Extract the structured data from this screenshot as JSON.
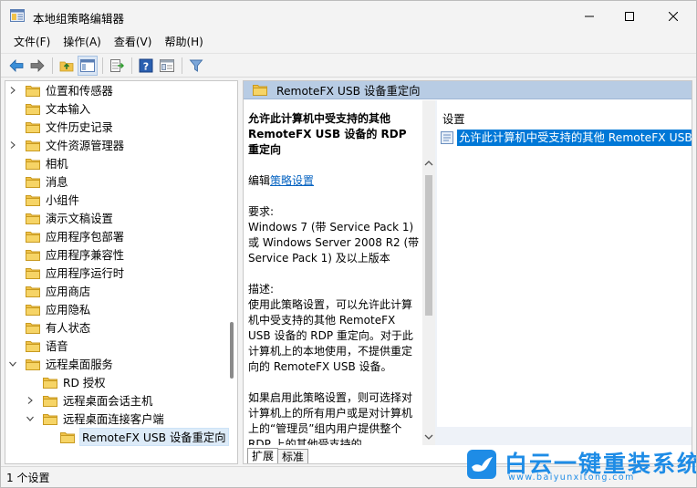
{
  "window": {
    "title": "本地组策略编辑器",
    "colors": {
      "accent": "#0078d7",
      "header": "#b8cce4",
      "folder": "#f0c24a"
    }
  },
  "menu": [
    "文件(F)",
    "操作(A)",
    "查看(V)",
    "帮助(H)"
  ],
  "toolbar_icons": [
    "back-arrow-icon",
    "forward-arrow-icon",
    "up-folder-icon",
    "show-hide-tree-icon",
    "export-list-icon",
    "help-icon",
    "properties-icon",
    "filter-icon"
  ],
  "tree": {
    "items": [
      {
        "label": "位置和传感器",
        "expander": "right"
      },
      {
        "label": "文本输入",
        "expander": "none"
      },
      {
        "label": "文件历史记录",
        "expander": "none"
      },
      {
        "label": "文件资源管理器",
        "expander": "right"
      },
      {
        "label": "相机",
        "expander": "none"
      },
      {
        "label": "消息",
        "expander": "none"
      },
      {
        "label": "小组件",
        "expander": "none"
      },
      {
        "label": "演示文稿设置",
        "expander": "none"
      },
      {
        "label": "应用程序包部署",
        "expander": "none"
      },
      {
        "label": "应用程序兼容性",
        "expander": "none"
      },
      {
        "label": "应用程序运行时",
        "expander": "none"
      },
      {
        "label": "应用商店",
        "expander": "none"
      },
      {
        "label": "应用隐私",
        "expander": "none"
      },
      {
        "label": "有人状态",
        "expander": "none"
      },
      {
        "label": "语音",
        "expander": "none"
      },
      {
        "label": "远程桌面服务",
        "expander": "down"
      },
      {
        "label": "RD 授权",
        "expander": "none"
      },
      {
        "label": "远程桌面会话主机",
        "expander": "right"
      },
      {
        "label": "远程桌面连接客户端",
        "expander": "down"
      },
      {
        "label": "RemoteFX USB 设备重定向",
        "expander": "none",
        "selected": true
      }
    ]
  },
  "right_panel": {
    "header": "RemoteFX USB 设备重定向",
    "description": {
      "title": "允许此计算机中受支持的其他 RemoteFX USB 设备的 RDP 重定向",
      "edit_prefix": "编辑",
      "edit_link": "策略设置",
      "requirements_label": "要求:",
      "requirements_text": "Windows 7 (带 Service Pack 1) 或 Windows Server 2008 R2 (带 Service Pack 1) 及以上版本",
      "desc_label": "描述:",
      "desc_text": "使用此策略设置，可以允许此计算机中受支持的其他 RemoteFX USB 设备的 RDP 重定向。对于此计算机上的本地使用，不提供重定向的 RemoteFX USB 设备。",
      "desc_text2": "如果启用此策略设置，则可选择对计算机上的所有用户或是对计算机上的“管理员”组内用户提供整个 RDP 上的其他受支持的 RemoteFX USB 设备的重定向功能"
    },
    "settings_header": "设置",
    "settings_item": "允许此计算机中受支持的其他 RemoteFX USB 设备",
    "tabs": [
      "扩展",
      "标准"
    ]
  },
  "status": "1 个设置",
  "watermark": {
    "title": "白云一键重装系统",
    "url": "www.baiyunxitong.com"
  }
}
